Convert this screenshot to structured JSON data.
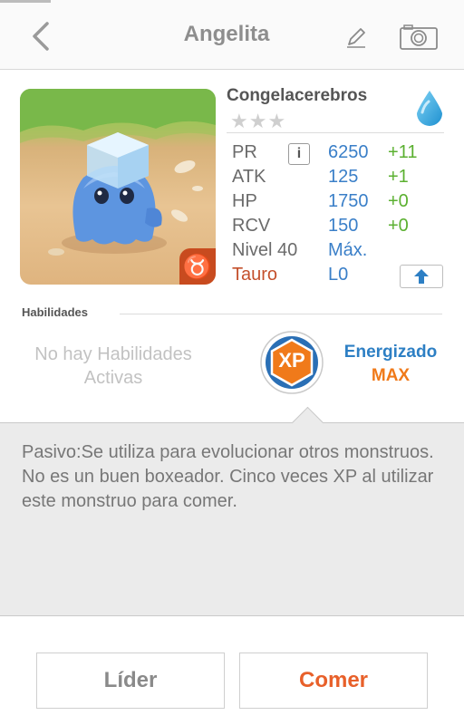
{
  "header": {
    "title": "Angelita",
    "back_icon": "chevron-left-icon",
    "edit_icon": "pencil-icon",
    "camera_icon": "camera-icon"
  },
  "monster": {
    "name": "Congelacerebros",
    "rarity_stars": "★★★",
    "element_icon": "water-drop-icon",
    "zodiac_symbol": "♉",
    "stats": [
      {
        "label": "PR",
        "value": "6250",
        "bonus": "+11"
      },
      {
        "label": "ATK",
        "value": "125",
        "bonus": "+1"
      },
      {
        "label": "HP",
        "value": "1750",
        "bonus": "+0"
      },
      {
        "label": "RCV",
        "value": "150",
        "bonus": "+0"
      }
    ],
    "info_label": "i",
    "level_label": "Nivel 40",
    "level_value": "Máx.",
    "zodiac_name": "Tauro",
    "zodiac_level": "L0"
  },
  "skills": {
    "section_label": "Habilidades",
    "no_active": "No hay Habilidades Activas",
    "badge_text": "XP",
    "awaken_name": "Energizado",
    "awaken_level": "MAX",
    "description": "Pasivo:Se utiliza para evolucionar otros monstruos. No es un buen boxeador. Cinco veces XP al utilizar este monstruo para comer."
  },
  "buttons": {
    "leader": "Líder",
    "eat": "Comer"
  },
  "colors": {
    "accent_blue": "#2d7fc4",
    "accent_orange": "#f07a1a",
    "bonus_green": "#5bb030",
    "eat_button": "#e8602a"
  }
}
